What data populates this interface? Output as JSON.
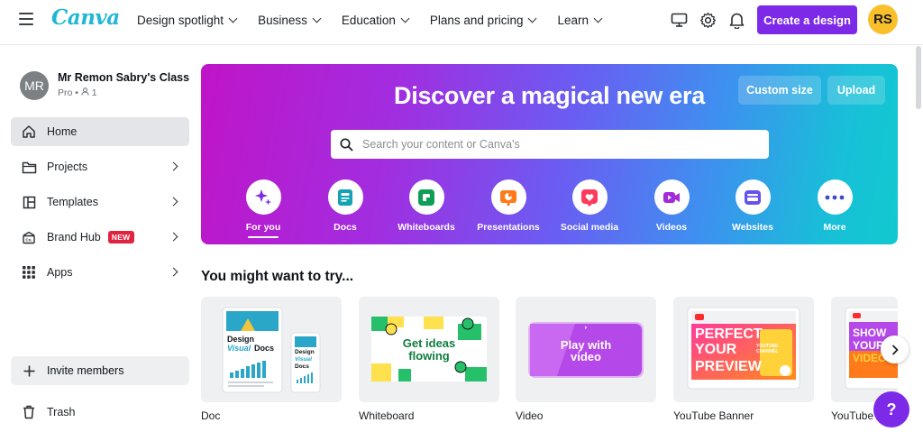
{
  "topnav": {
    "logo": "Canva",
    "links": [
      "Design spotlight",
      "Business",
      "Education",
      "Plans and pricing",
      "Learn"
    ],
    "create_label": "Create a design",
    "avatar_initials": "RS",
    "icons": [
      "desktop-icon",
      "gear-icon",
      "bell-icon"
    ]
  },
  "sidebar": {
    "team": {
      "initials": "MR",
      "name": "Mr Remon Sabry's Class",
      "plan": "Pro",
      "members": "1"
    },
    "items": [
      {
        "label": "Home",
        "icon": "home-icon",
        "active": true
      },
      {
        "label": "Projects",
        "icon": "folder-icon"
      },
      {
        "label": "Templates",
        "icon": "templates-icon"
      },
      {
        "label": "Brand Hub",
        "icon": "brand-icon",
        "badge": "NEW"
      },
      {
        "label": "Apps",
        "icon": "apps-grid-icon"
      }
    ],
    "invite_label": "Invite members",
    "trash_label": "Trash"
  },
  "hero": {
    "title": "Discover a magical new era",
    "custom_size_label": "Custom size",
    "upload_label": "Upload",
    "search_placeholder": "Search your content or Canva's",
    "categories": [
      {
        "label": "For you",
        "color": "#7d2ae8",
        "selected": true
      },
      {
        "label": "Docs",
        "color": "#13a3b5"
      },
      {
        "label": "Whiteboards",
        "color": "#0f9e55"
      },
      {
        "label": "Presentations",
        "color": "#ff7a1a"
      },
      {
        "label": "Social media",
        "color": "#ff3b5c"
      },
      {
        "label": "Videos",
        "color": "#a32bd8"
      },
      {
        "label": "Websites",
        "color": "#6452f0"
      },
      {
        "label": "More",
        "color": "#3d4dbe"
      }
    ]
  },
  "suggestions": {
    "title": "You might want to try...",
    "cards": [
      {
        "label": "Doc",
        "thumb_text": [
          "Design",
          "Visual",
          "Docs"
        ]
      },
      {
        "label": "Whiteboard",
        "thumb_text": [
          "Get ideas",
          "flowing"
        ]
      },
      {
        "label": "Video",
        "thumb_text": [
          "Play with",
          "video"
        ]
      },
      {
        "label": "YouTube Banner",
        "thumb_text": [
          "PERFECT",
          "YOUR",
          "PREVIEW",
          "YOUTUBE",
          "CHANNEL"
        ]
      },
      {
        "label": "YouTube",
        "thumb_text": [
          "SHOW",
          "YOUR",
          "VIDEOS"
        ]
      }
    ],
    "help_label": "?"
  },
  "colors": {
    "brand_purple": "#7d2ae8",
    "avatar_yellow": "#f9c02c",
    "logo_teal": "#20b7d6"
  }
}
